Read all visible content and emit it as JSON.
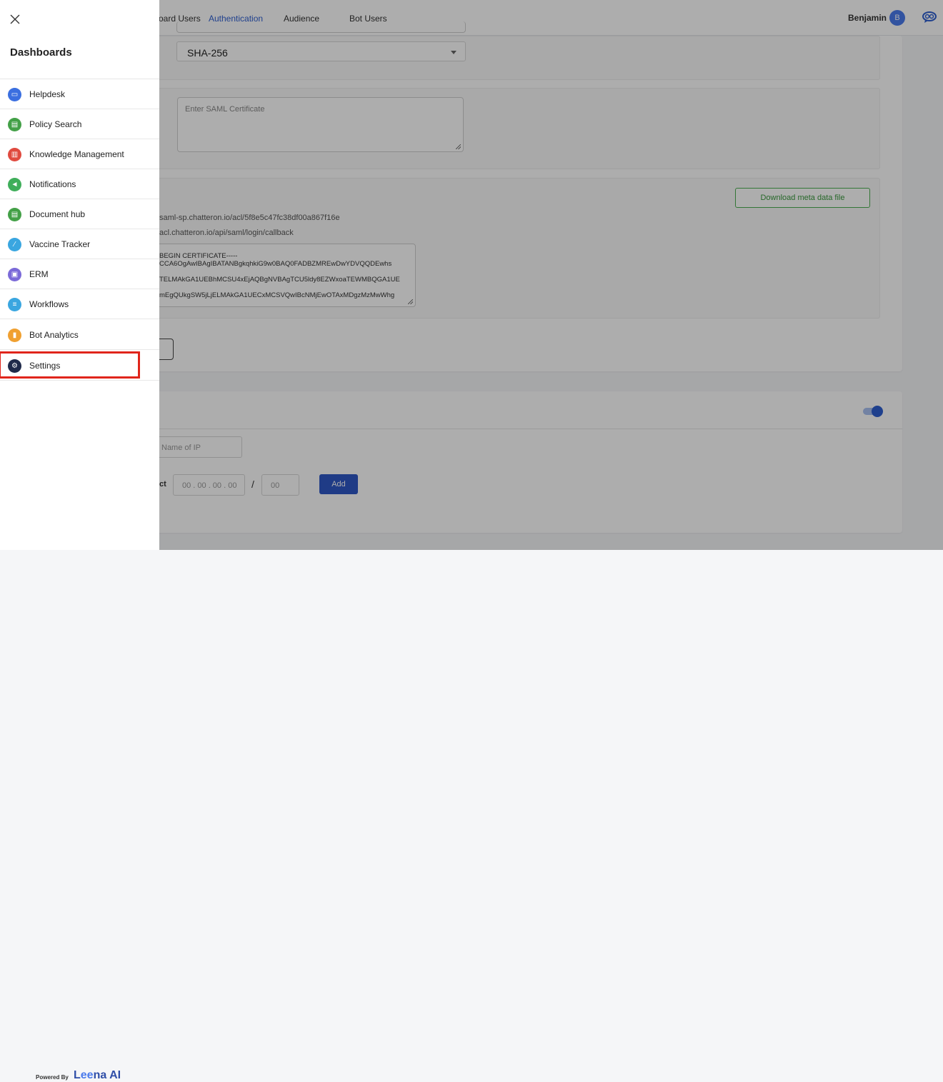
{
  "header": {
    "tabs": [
      {
        "label": "oard Users"
      },
      {
        "label": "Authentication"
      },
      {
        "label": "Audience"
      },
      {
        "label": "Bot Users"
      }
    ],
    "user_name": "Benjamin",
    "avatar_initial": "B",
    "accent_color": "#2f5fd0"
  },
  "saml": {
    "algorithm_selected": "SHA-256",
    "certificate_placeholder": "Enter SAML Certificate",
    "download_label": "Download meta data file",
    "entity_id": "saml-sp.chatteron.io/acl/5f8e5c47fc38df00a867f16e",
    "callback_url": "acl.chatteron.io/api/saml/login/callback",
    "certificate_lines": [
      "BEGIN CERTIFICATE-----",
      "CCA6OgAwIBAgIBATANBgkqhkiG9w0BAQ0FADBZMREwDwYDVQQDEwhs",
      "",
      "TELMAkGA1UEBhMCSU4xEjAQBgNVBAgTCU5ldy8EZWxoaTEWMBQGA1UE",
      "",
      "mEgQUkgSW5jLjELMAkGA1UECxMCSVQwIBcNMjEwOTAxMDgzMzMwWhg"
    ]
  },
  "ip": {
    "name_placeholder": "Name of IP",
    "subnet_label_partial": "ct",
    "ip_placeholder": "00 . 00 . 00 . 00",
    "slash": "/",
    "mask_placeholder": "00",
    "add_label": "Add",
    "toggle_on": true
  },
  "drawer": {
    "title": "Dashboards",
    "items": [
      {
        "label": "Helpdesk",
        "icon": "ticket-icon",
        "glyph": "▭",
        "color": "#3b6fe0"
      },
      {
        "label": "Policy Search",
        "icon": "document-icon",
        "glyph": "▤",
        "color": "#43a047"
      },
      {
        "label": "Knowledge Management",
        "icon": "book-icon",
        "glyph": "▥",
        "color": "#e04a3f"
      },
      {
        "label": "Notifications",
        "icon": "megaphone-icon",
        "glyph": "◄",
        "color": "#3fae5a"
      },
      {
        "label": "Document hub",
        "icon": "file-icon",
        "glyph": "▤",
        "color": "#43a047"
      },
      {
        "label": "Vaccine Tracker",
        "icon": "syringe-icon",
        "glyph": "⁄",
        "color": "#3aa6e0"
      },
      {
        "label": "ERM",
        "icon": "clipboard-icon",
        "glyph": "▣",
        "color": "#7b6ad8"
      },
      {
        "label": "Workflows",
        "icon": "workflow-icon",
        "glyph": "≡",
        "color": "#3aa6e0"
      },
      {
        "label": "Bot Analytics",
        "icon": "bar-chart-icon",
        "glyph": "▮",
        "color": "#f0a030"
      },
      {
        "label": "Settings",
        "icon": "gear-icon",
        "glyph": "⚙",
        "color": "#1f2a4a"
      }
    ],
    "powered_by": "Powered By",
    "brand_prefix": "L",
    "brand_ee": "ee",
    "brand_suffix": "na AI",
    "highlight_color": "#e0251b"
  }
}
